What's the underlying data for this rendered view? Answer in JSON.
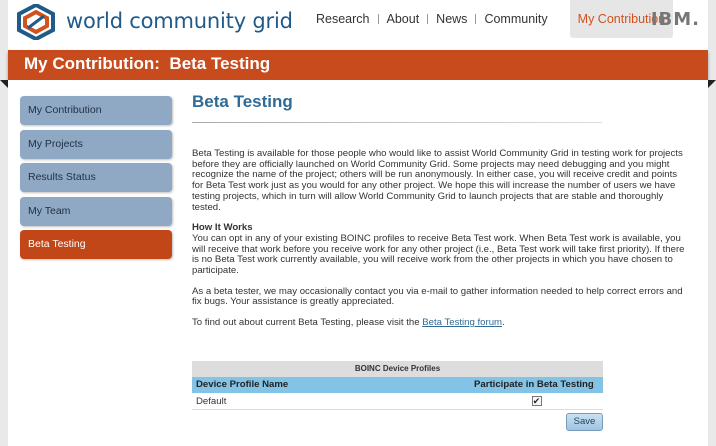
{
  "header": {
    "brand": "world community grid",
    "ibm": "IBM.",
    "nav": [
      "Research",
      "About",
      "News",
      "Community"
    ],
    "nav_active": "My Contribution"
  },
  "band": {
    "title": "My Contribution:  Beta Testing"
  },
  "sidebar": {
    "items": [
      {
        "label": "My Contribution"
      },
      {
        "label": "My Projects"
      },
      {
        "label": "Results Status"
      },
      {
        "label": "My Team"
      },
      {
        "label": "Beta Testing"
      }
    ]
  },
  "main": {
    "title": "Beta Testing",
    "intro": "Beta Testing is available for those people who would like to assist World Community Grid in testing work for projects before they are officially launched on World Community Grid. Some projects may need debugging and you might recognize the name of the project; others will be run anonymously. In either case, you will receive credit and points for Beta Test work just as you would for any other project. We hope this will increase the number of users we have testing projects, which in turn will allow World Community Grid to launch projects that are stable and thoroughly tested.",
    "how_heading": "How It Works",
    "how_text": "You can opt in any of your existing BOINC profiles to receive Beta Test work. When Beta Test work is available, you will receive that work before you receive work for any other project (i.e., Beta Test work will take first priority). If there is no Beta Test work currently available, you will receive work from the other projects in which you have chosen to participate.",
    "contact_text": "As a beta tester, we may occasionally contact you via e-mail to gather information needed to help correct errors and fix bugs. Your assistance is greatly appreciated.",
    "forum_prefix": "To find out about current Beta Testing, please visit the ",
    "forum_link": "Beta Testing forum",
    "forum_suffix": "."
  },
  "table": {
    "caption": "BOINC Device Profiles",
    "columns": [
      "Device Profile Name",
      "Participate in Beta Testing"
    ],
    "rows": [
      {
        "name": "Default",
        "participate": "✔"
      }
    ],
    "save_label": "Save"
  },
  "colors": {
    "accent": "#c74b1c",
    "sidebar": "#8fa8c3",
    "title": "#2f6b95",
    "table_head": "#83c3e6"
  }
}
